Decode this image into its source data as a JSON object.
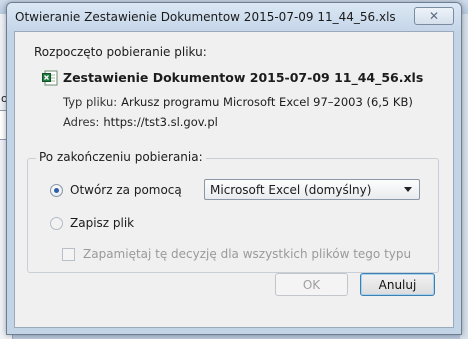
{
  "dialog": {
    "title": "Otwieranie Zestawienie Dokumentow 2015-07-09 11_44_56.xls",
    "close_symbol": "✕"
  },
  "download": {
    "intro": "Rozpoczęto pobieranie pliku:",
    "file_name": "Zestawienie Dokumentow 2015-07-09 11_44_56.xls",
    "file_icon": "excel-file-icon",
    "type_label": "Typ pliku:",
    "type_value": "Arkusz programu Microsoft Excel 97–2003 (6,5 KB)",
    "address_label": "Adres:",
    "address_value": "https://tst3.sl.gov.pl"
  },
  "after_download": {
    "legend": "Po zakończeniu pobierania:",
    "open_with_label": "Otwórz za pomocą",
    "open_with_selected": true,
    "app_selected": "Microsoft Excel (domyślny)",
    "save_label": "Zapisz plik",
    "save_selected": false,
    "remember_label": "Zapamiętaj tę decyzję dla wszystkich plików tego typu",
    "remember_checked": false
  },
  "buttons": {
    "ok_label": "OK",
    "cancel_label": "Anuluj"
  },
  "background": {
    "left_fragment_text": "o"
  },
  "colors": {
    "accent": "#2d5ea9",
    "excel_green": "#1f7a3d",
    "disabled_text": "#9a9a9a"
  }
}
